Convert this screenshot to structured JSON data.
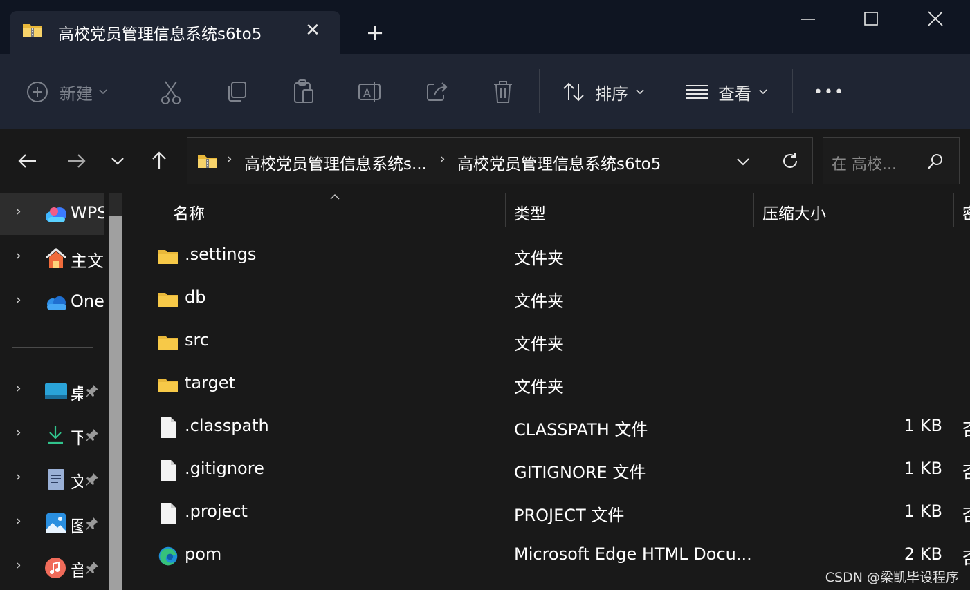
{
  "window": {
    "tab_title": "高校党员管理信息系统s6to5",
    "new_tab": "+",
    "tab_close": "✕"
  },
  "toolbar": {
    "new_label": "新建",
    "sort_label": "排序",
    "view_label": "查看",
    "more": "•••"
  },
  "navigation": {
    "breadcrumbs": [
      "高校党员管理信息系统s...",
      "高校党员管理信息系统s6to5"
    ],
    "breadcrumb_separator": "›",
    "search_placeholder": "在 高校..."
  },
  "sidebar": {
    "items": [
      {
        "label": "WPS",
        "icon": "wps-cloud-icon",
        "pinned": false
      },
      {
        "label": "主文",
        "icon": "home-icon",
        "pinned": false
      },
      {
        "label": "One",
        "icon": "onedrive-icon",
        "pinned": false
      },
      {
        "label": "桌",
        "icon": "desktop-icon",
        "pinned": true
      },
      {
        "label": "下",
        "icon": "downloads-icon",
        "pinned": true
      },
      {
        "label": "文",
        "icon": "documents-icon",
        "pinned": true
      },
      {
        "label": "图",
        "icon": "pictures-icon",
        "pinned": true
      },
      {
        "label": "音",
        "icon": "music-icon",
        "pinned": true
      }
    ]
  },
  "file_list": {
    "columns": [
      "名称",
      "类型",
      "压缩大小",
      "密"
    ],
    "files": [
      {
        "name": ".settings",
        "type": "文件夹",
        "size": "",
        "extra": "",
        "icon": "folder-icon"
      },
      {
        "name": "db",
        "type": "文件夹",
        "size": "",
        "extra": "",
        "icon": "folder-icon"
      },
      {
        "name": "src",
        "type": "文件夹",
        "size": "",
        "extra": "",
        "icon": "folder-icon"
      },
      {
        "name": "target",
        "type": "文件夹",
        "size": "",
        "extra": "",
        "icon": "folder-icon"
      },
      {
        "name": ".classpath",
        "type": "CLASSPATH 文件",
        "size": "1 KB",
        "extra": "否",
        "icon": "file-icon"
      },
      {
        "name": ".gitignore",
        "type": "GITIGNORE 文件",
        "size": "1 KB",
        "extra": "否",
        "icon": "file-icon"
      },
      {
        "name": ".project",
        "type": "PROJECT 文件",
        "size": "1 KB",
        "extra": "否",
        "icon": "file-icon"
      },
      {
        "name": "pom",
        "type": "Microsoft Edge HTML Docu...",
        "size": "2 KB",
        "extra": "否",
        "icon": "edge-icon"
      }
    ]
  },
  "watermark": "CSDN @梁凯毕设程序",
  "colors": {
    "titlebar": "#0f1522",
    "toolbar": "#1f2533",
    "background": "#191919",
    "folder": "#f7c948"
  }
}
